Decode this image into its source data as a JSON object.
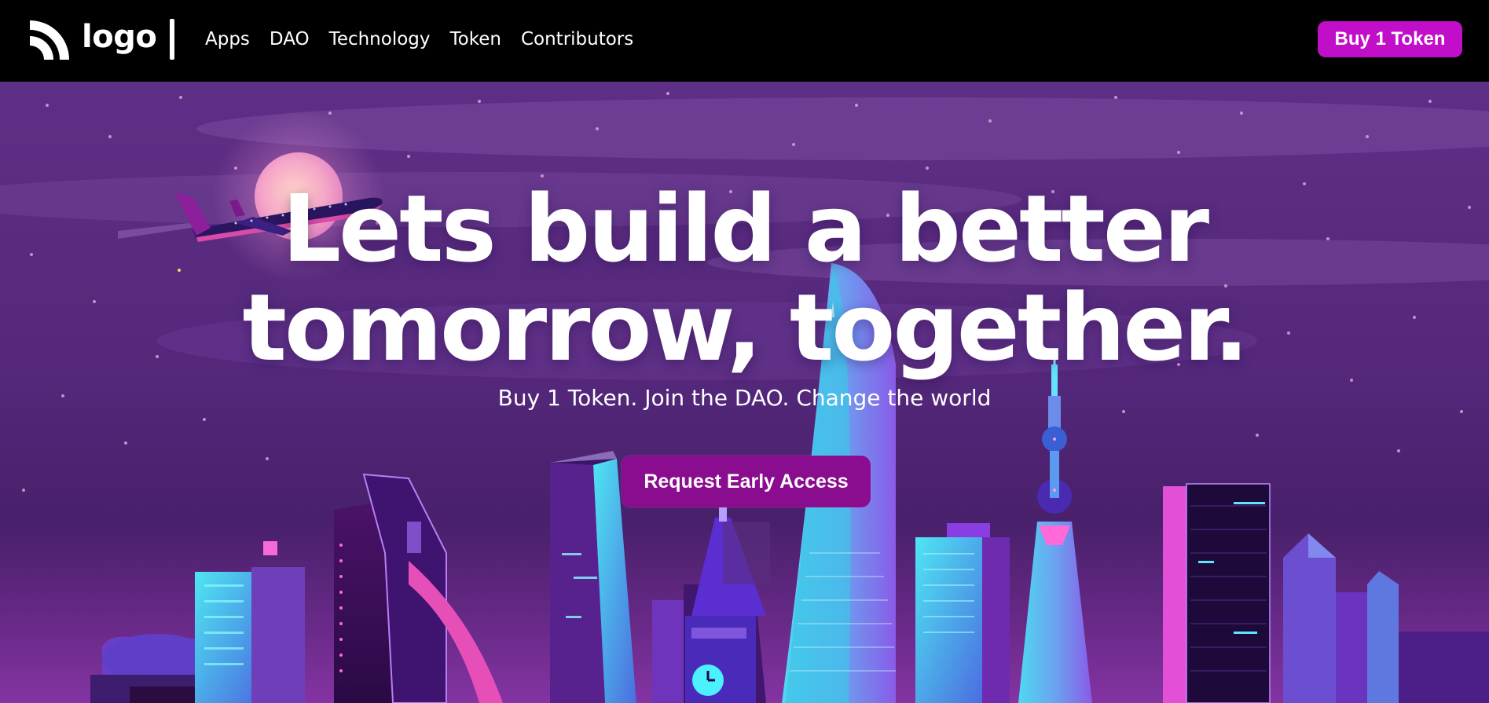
{
  "header": {
    "logo_text": "logo",
    "nav": [
      "Apps",
      "DAO",
      "Technology",
      "Token",
      "Contributors"
    ],
    "buy_button": "Buy 1 Token"
  },
  "hero": {
    "headline_line1": "Lets build a better",
    "headline_line2": "tomorrow, together.",
    "subheadline": "Buy 1 Token. Join the DAO. Change the world",
    "cta_button": "Request Early Access"
  },
  "icons": {
    "logo": "rss-like-logo-icon"
  },
  "colors": {
    "topbar": "#000000",
    "accent": "#c10ec8",
    "cta": "#8a0d8f",
    "sky_top": "#5e2f86",
    "sky_bottom": "#3b1758"
  }
}
